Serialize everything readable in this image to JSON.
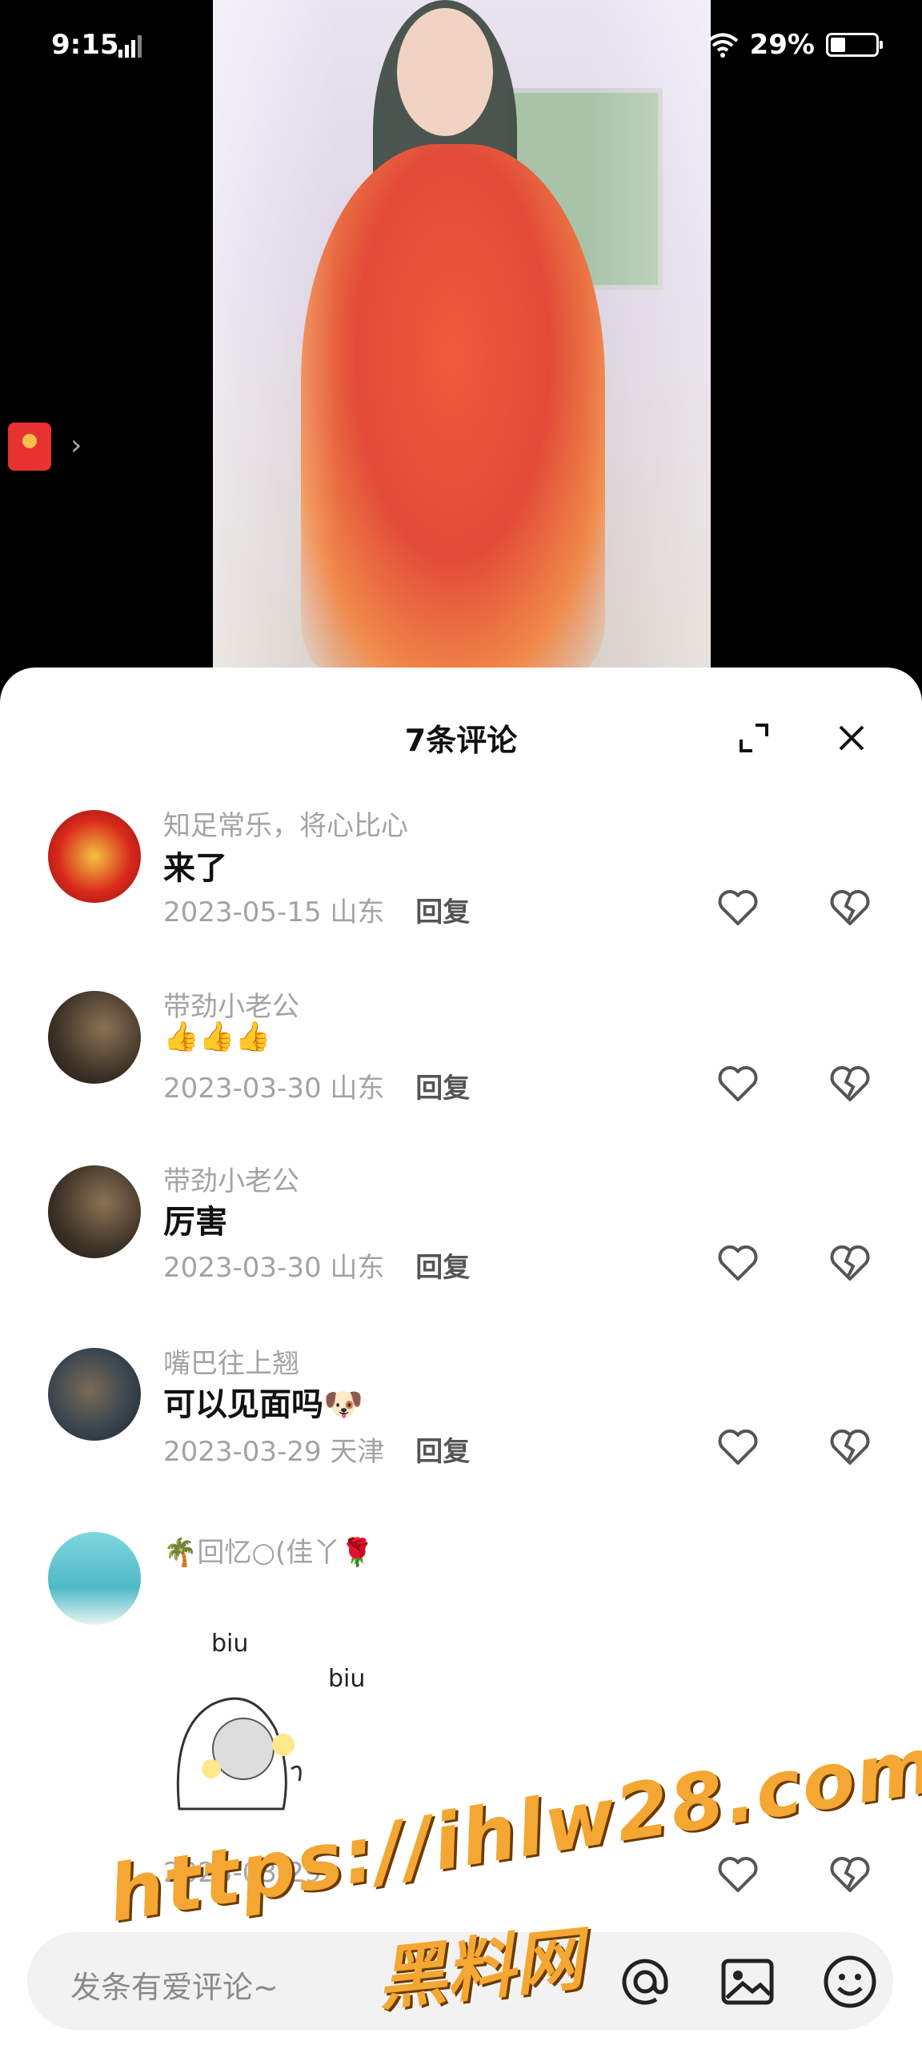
{
  "status_bar": {
    "time": "9:15",
    "battery": "29%",
    "icons": [
      "signal-icon",
      "wifi-icon",
      "battery-icon"
    ]
  },
  "video": {
    "description_icon": "video-player"
  },
  "red_packet": {
    "icon": "red-packet-icon",
    "arrow": "›"
  },
  "comments_panel": {
    "title": "7条评论",
    "comments": [
      {
        "name": "知足常乐，将心比心",
        "text": "来了",
        "date": "2023-05-15",
        "region": "山东",
        "reply": "回复"
      },
      {
        "name": "带劲小老公",
        "text": "👍👍👍",
        "date": "2023-03-30",
        "region": "山东",
        "reply": "回复"
      },
      {
        "name": "带劲小老公",
        "text": "厉害",
        "date": "2023-03-30",
        "region": "山东",
        "reply": "回复"
      },
      {
        "name": "嘴巴往上翘",
        "text": "可以见面吗🐶",
        "date": "2023-03-29",
        "region": "天津",
        "reply": "回复"
      },
      {
        "name": "🌴回忆○(佳丫🌹",
        "sticker_text1": "biu",
        "sticker_text2": "biu",
        "date": "2023-03-29"
      }
    ]
  },
  "input_bar": {
    "placeholder": "发条有爱评论~"
  },
  "watermark": {
    "line1": "https://ihlw28.com",
    "line2": "黑料网"
  }
}
